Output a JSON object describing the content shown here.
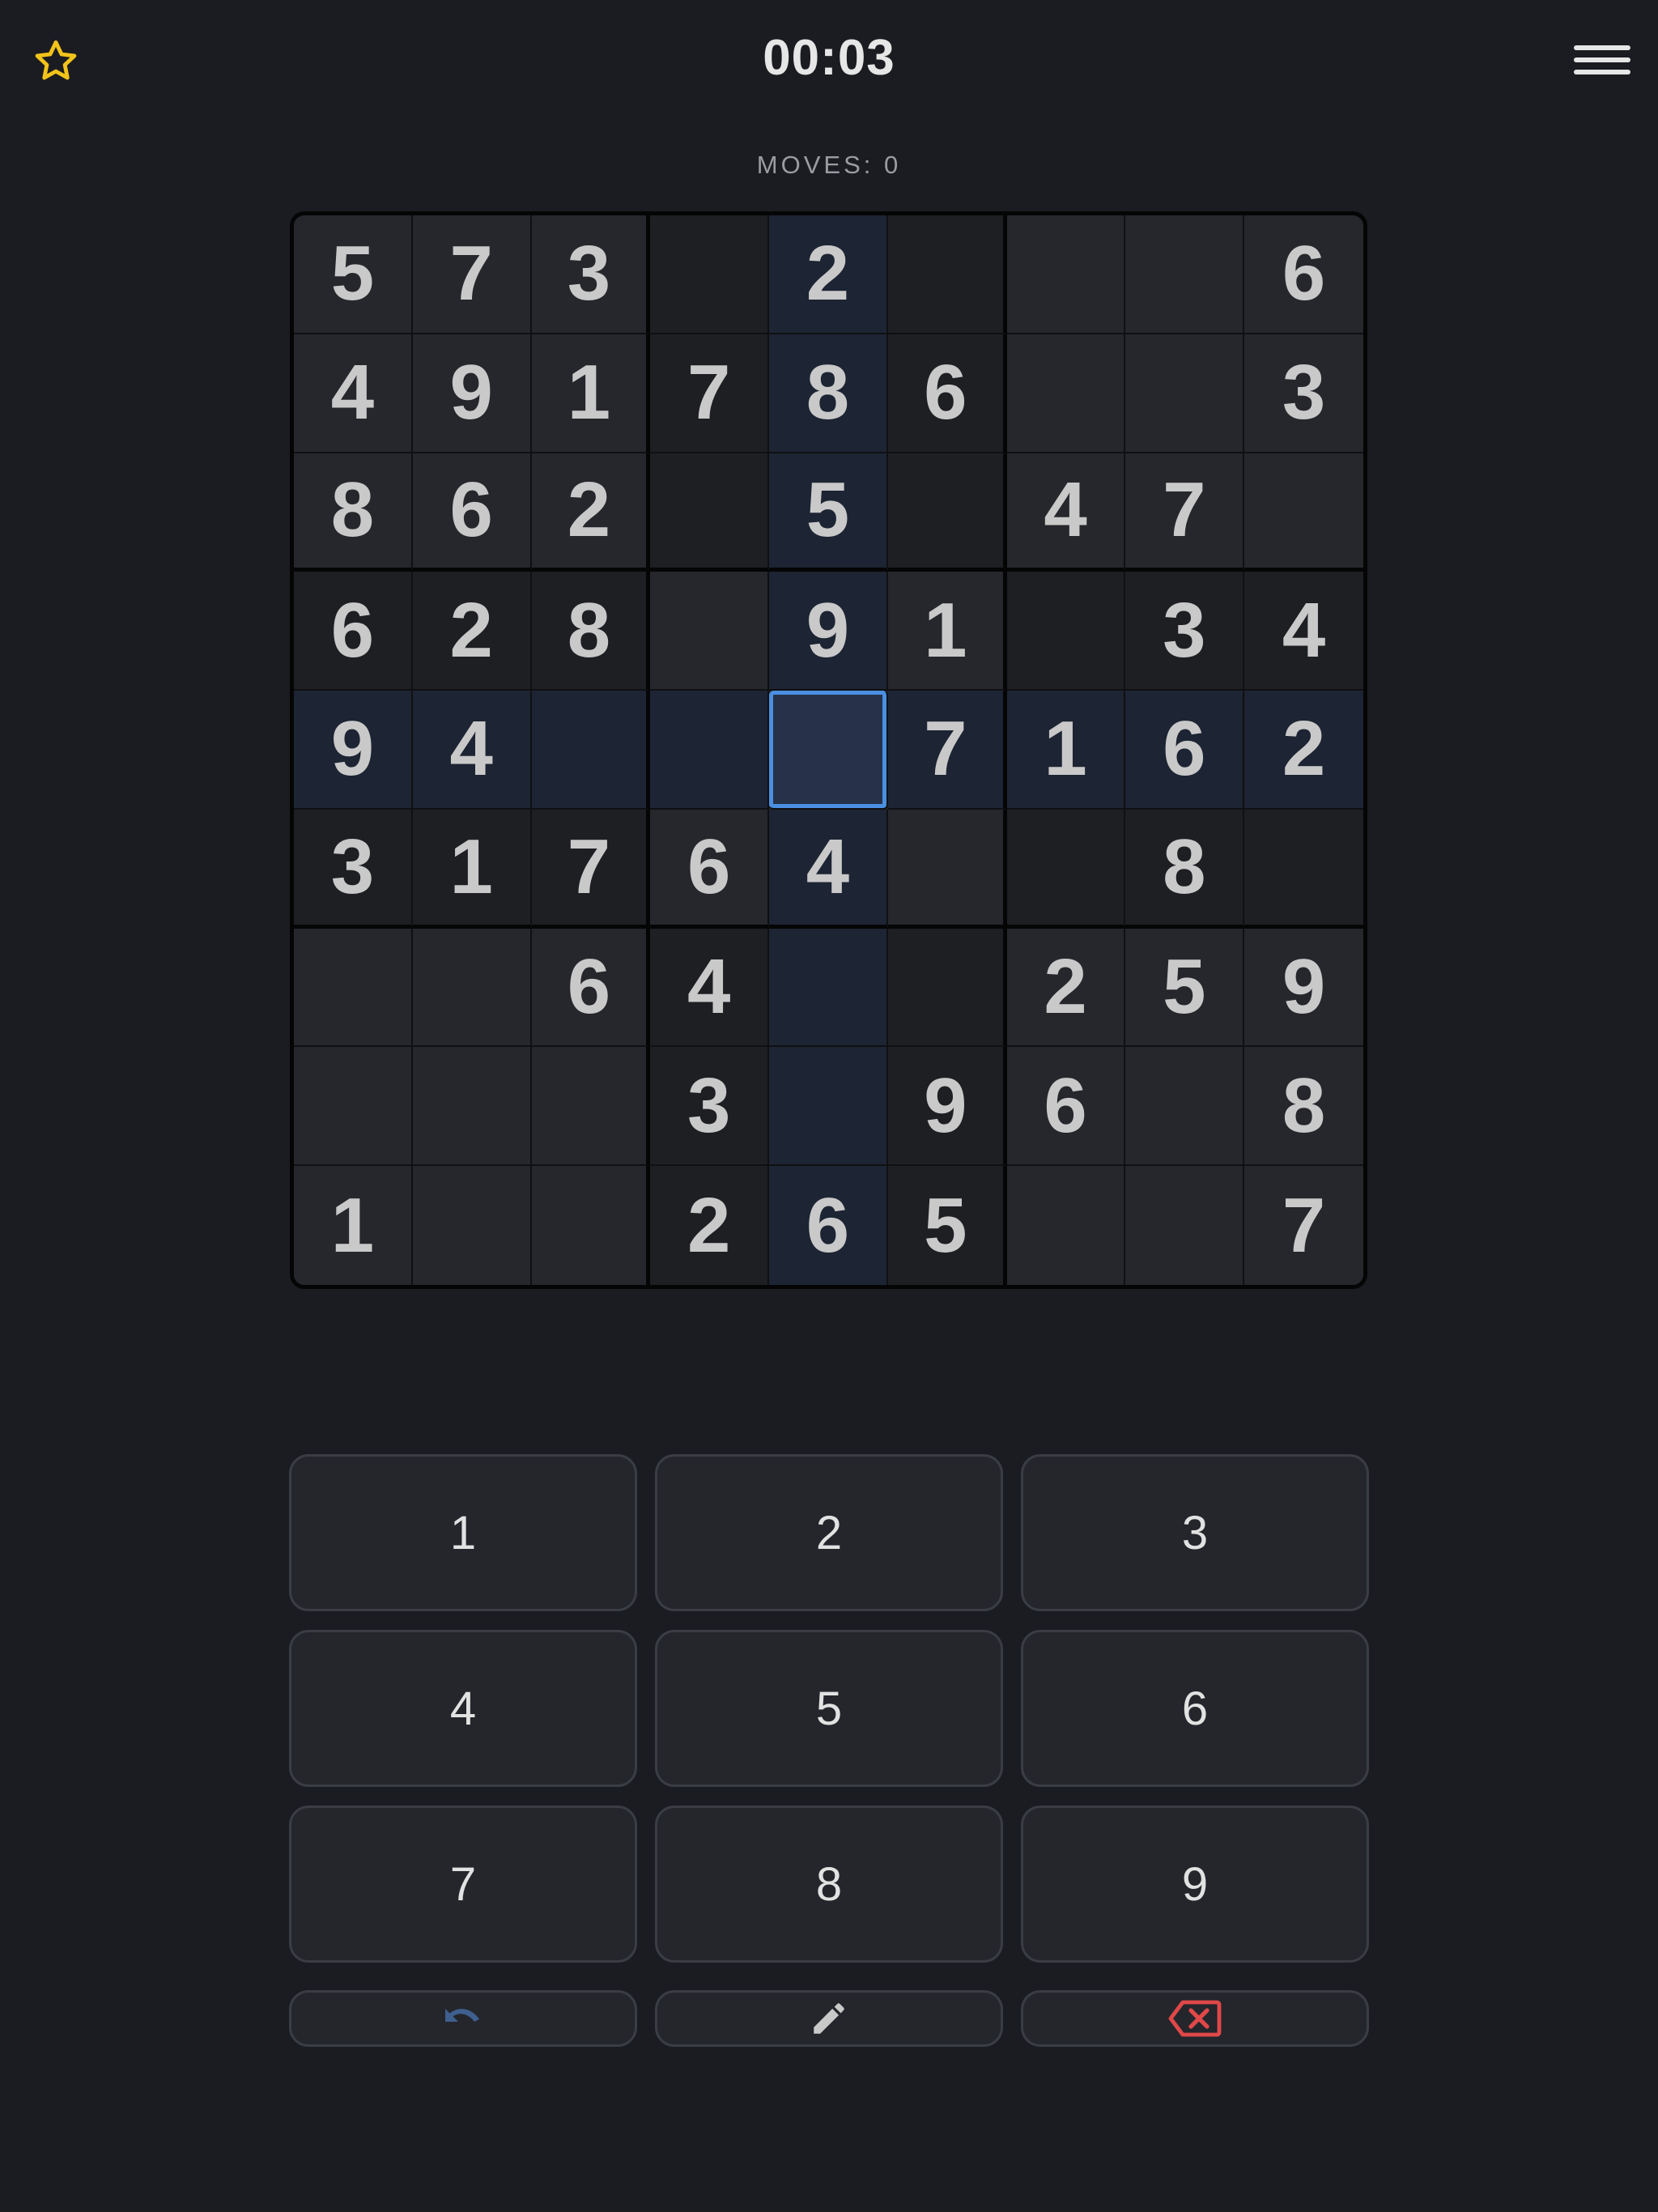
{
  "header": {
    "favorite_icon": "star-outline-icon",
    "timer": "00:03",
    "menu_icon": "hamburger-menu-icon"
  },
  "status": {
    "moves_label": "MOVES: 0"
  },
  "board": {
    "rows": [
      [
        "5",
        "7",
        "3",
        "",
        "2",
        "",
        "",
        "",
        "6"
      ],
      [
        "4",
        "9",
        "1",
        "7",
        "8",
        "6",
        "",
        "",
        "3"
      ],
      [
        "8",
        "6",
        "2",
        "",
        "5",
        "",
        "4",
        "7",
        ""
      ],
      [
        "6",
        "2",
        "8",
        "",
        "9",
        "1",
        "",
        "3",
        "4"
      ],
      [
        "9",
        "4",
        "",
        "",
        "",
        "7",
        "1",
        "6",
        "2"
      ],
      [
        "3",
        "1",
        "7",
        "6",
        "4",
        "",
        "",
        "8",
        ""
      ],
      [
        "",
        "",
        "6",
        "4",
        "",
        "",
        "2",
        "5",
        "9"
      ],
      [
        "",
        "",
        "",
        "3",
        "",
        "9",
        "6",
        "",
        "8"
      ],
      [
        "1",
        "",
        "",
        "2",
        "6",
        "5",
        "",
        "",
        "7"
      ]
    ],
    "selected_cell": {
      "row": 4,
      "col": 4
    }
  },
  "keypad": {
    "keys": [
      "1",
      "2",
      "3",
      "4",
      "5",
      "6",
      "7",
      "8",
      "9"
    ]
  },
  "tools": {
    "undo_icon": "undo-icon",
    "pencil_icon": "pencil-icon",
    "erase_icon": "backspace-erase-icon"
  },
  "colors": {
    "background": "#1b1c21",
    "star": "#f2c31a",
    "selection": "#4a8fe2",
    "erase": "#e04848",
    "undo": "#3f5f8f"
  }
}
